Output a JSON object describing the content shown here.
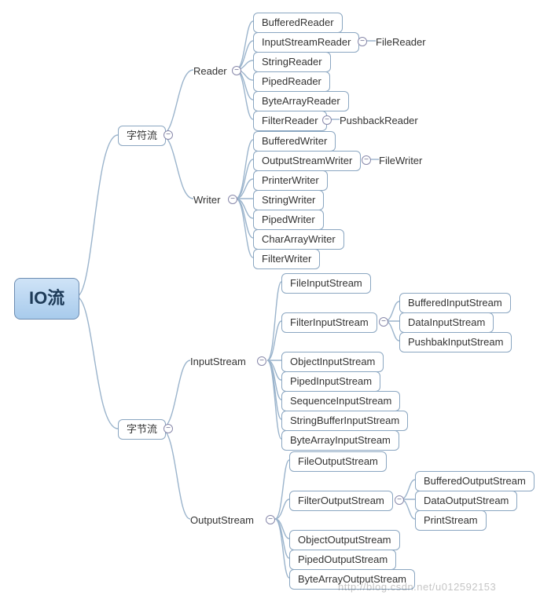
{
  "root": "IO流",
  "char_stream": "字符流",
  "byte_stream": "字节流",
  "reader": "Reader",
  "writer": "Writer",
  "input_stream": "InputStream",
  "output_stream": "OutputStream",
  "reader_children": {
    "buffered": "BufferedReader",
    "isr": "InputStreamReader",
    "string": "StringReader",
    "piped": "PipedReader",
    "bytearr": "ByteArrayReader",
    "filter": "FilterReader"
  },
  "reader_grand": {
    "filereader": "FileReader",
    "pushback": "PushbackReader"
  },
  "writer_children": {
    "buffered": "BufferedWriter",
    "osw": "OutputStreamWriter",
    "printer": "PrinterWriter",
    "string": "StringWriter",
    "piped": "PipedWriter",
    "chararr": "CharArrayWriter",
    "filter": "FilterWriter"
  },
  "writer_grand": {
    "filewriter": "FileWriter"
  },
  "is_children": {
    "file": "FileInputStream",
    "filter": "FilterInputStream",
    "object": "ObjectInputStream",
    "piped": "PipedInputStream",
    "sequence": "SequenceInputStream",
    "stringbuf": "StringBufferInputStream",
    "bytearr": "ByteArrayInputStream"
  },
  "is_grand": {
    "buffered": "BufferedInputStream",
    "data": "DataInputStream",
    "pushbak": "PushbakInputStream"
  },
  "os_children": {
    "file": "FileOutputStream",
    "filter": "FilterOutputStream",
    "object": "ObjectOutputStream",
    "piped": "PipedOutputStream",
    "bytearr": "ByteArrayOutputStream"
  },
  "os_grand": {
    "buffered": "BufferedOutputStream",
    "data": "DataOutputStream",
    "print": "PrintStream"
  },
  "toggle_glyph": "−",
  "watermark": "http://blog.csdn.net/u012592153"
}
